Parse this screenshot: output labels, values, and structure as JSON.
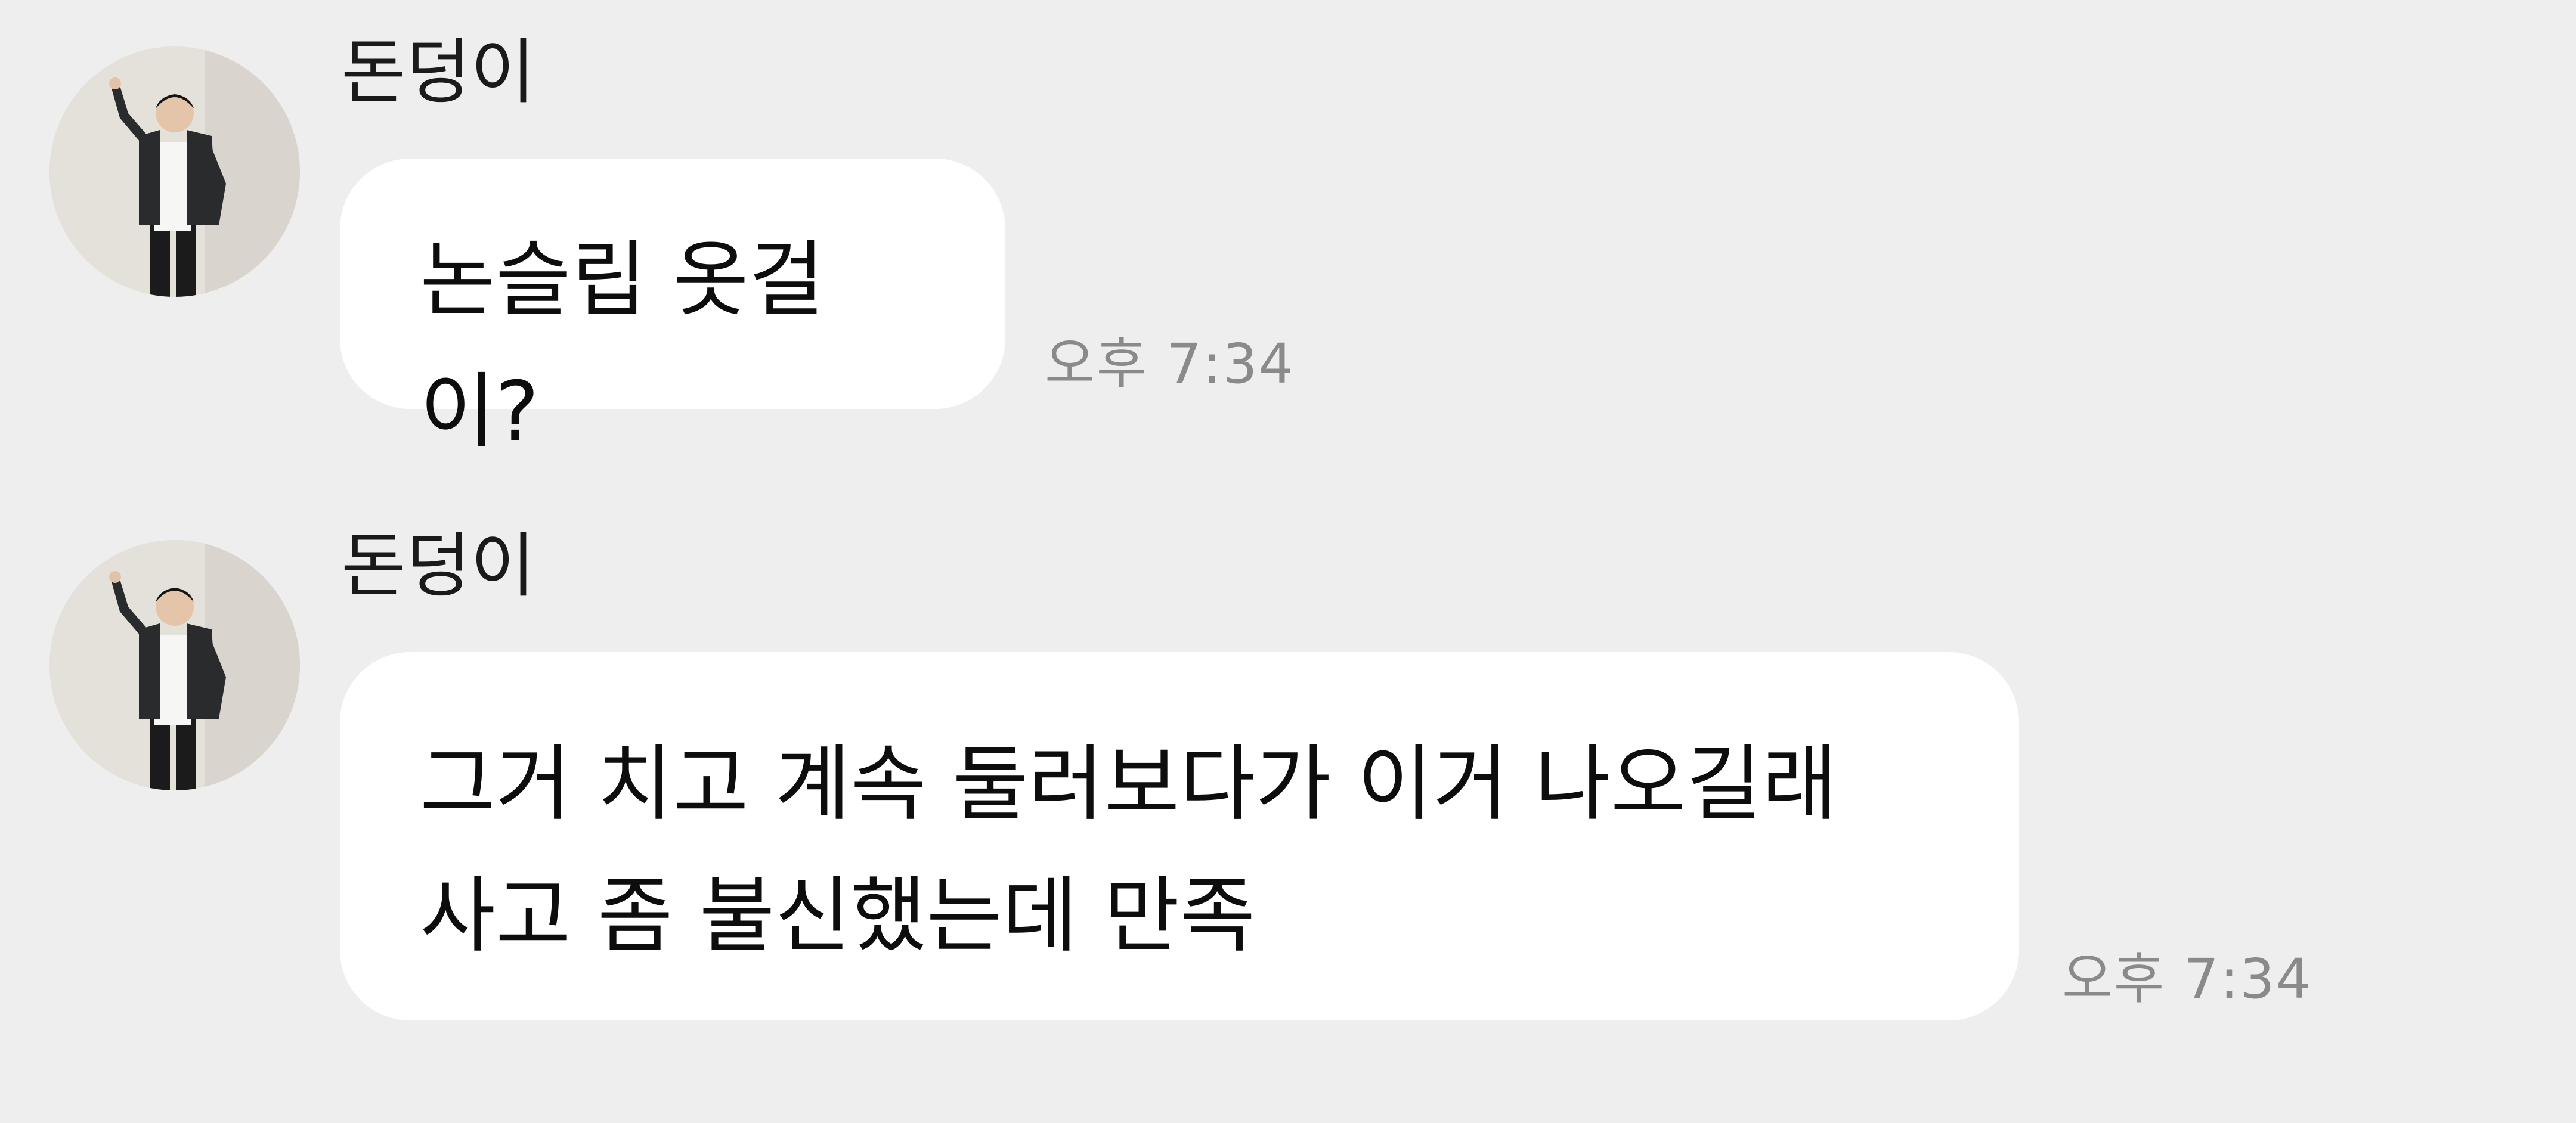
{
  "chat": {
    "messages": [
      {
        "sender": "돈덩이",
        "text": "논슬립 옷걸이?",
        "time": "오후 7:34"
      },
      {
        "sender": "돈덩이",
        "text": "그거 치고 계속 둘러보다가 이거 나오길래\n사고 좀 불신했는데 만족",
        "time": "오후 7:34"
      }
    ]
  },
  "colors": {
    "background": "#eeeeee",
    "bubble": "#ffffff",
    "timestamp": "#8a8a8a"
  }
}
